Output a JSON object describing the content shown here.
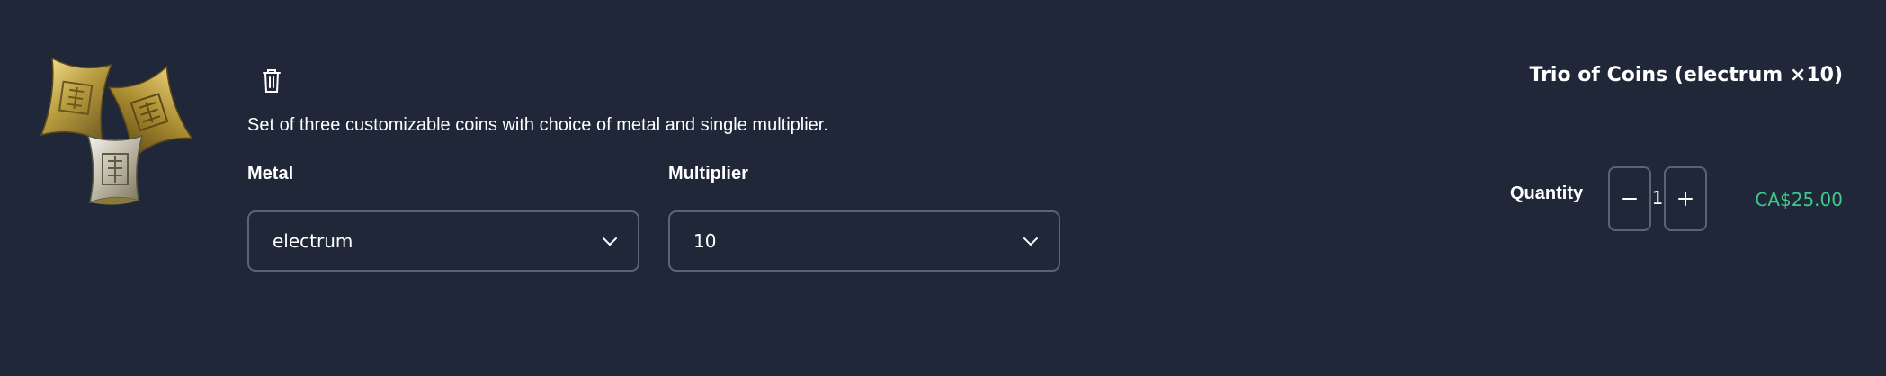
{
  "colors": {
    "background": "#1f2739",
    "border": "#5b6475",
    "text": "#ffffff",
    "price": "#3ec98a"
  },
  "item": {
    "image_icon": "coins-image",
    "delete_icon": "trash-icon",
    "description": "Set of three customizable coins with choice of metal and single multiplier.",
    "title": "Trio of Coins (electrum ×10)",
    "price": "CA$25.00"
  },
  "options": {
    "metal": {
      "label": "Metal",
      "selected": "electrum"
    },
    "multiplier": {
      "label": "Multiplier",
      "selected": "10"
    }
  },
  "quantity": {
    "label": "Quantity",
    "value": "1",
    "minus_icon": "minus-icon",
    "plus_icon": "plus-icon"
  }
}
